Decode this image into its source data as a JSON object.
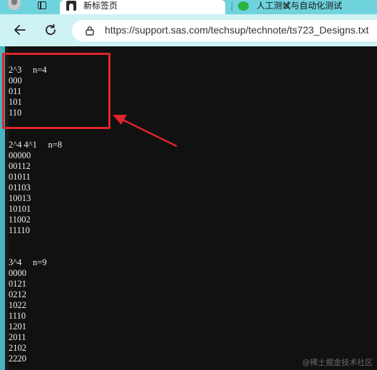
{
  "browser": {
    "tabs": [
      {
        "label": "新标签页"
      },
      {
        "label": "人工测试与自动化测试"
      }
    ],
    "tab_close_glyph": "×",
    "url": "https://support.sas.com/techsup/technote/ts723_Designs.txt",
    "colors": {
      "tabbar": "#6fd3dd",
      "toolbar": "#cff2f5",
      "content_bg": "#111111",
      "highlight": "#e0242a"
    }
  },
  "designs": [
    {
      "header": "2^3     n=4",
      "rows": [
        "000",
        "011",
        "101",
        "110"
      ]
    },
    {
      "header": "2^4 4^1     n=8",
      "rows": [
        "00000",
        "00112",
        "01011",
        "01103",
        "10013",
        "10101",
        "11002",
        "11110"
      ]
    },
    {
      "header": "3^4     n=9",
      "rows": [
        "0000",
        "0121",
        "0212",
        "1022",
        "1110",
        "1201",
        "2011",
        "2102",
        "2220"
      ]
    }
  ],
  "watermark": "@稀土掘金技术社区"
}
